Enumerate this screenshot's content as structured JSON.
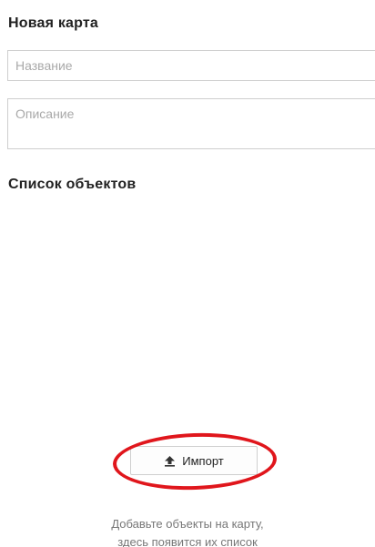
{
  "new_map": {
    "heading": "Новая карта",
    "name_placeholder": "Название",
    "name_value": "",
    "description_placeholder": "Описание",
    "description_value": ""
  },
  "objects_list": {
    "heading": "Список объектов",
    "import_button_label": "Импорт",
    "import_icon": "upload-icon",
    "empty_hint_line1": "Добавьте объекты на карту,",
    "empty_hint_line2": "здесь появится их список"
  },
  "annotation": {
    "highlight_color": "#e0161c"
  }
}
